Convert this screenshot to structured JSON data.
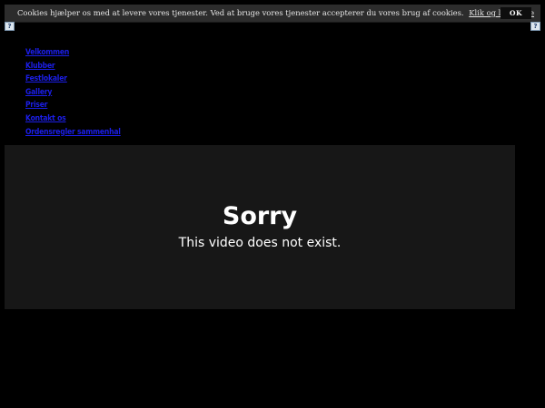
{
  "cookie_banner": {
    "text": "Cookies hjælper os med at levere vores tjenester. Ved at bruge vores tjenester accepterer du vores brug af cookies.",
    "link_label": "Klik og læs mere",
    "ok_label": "OK"
  },
  "help_icons": {
    "left_glyph": "?",
    "right_glyph": "?"
  },
  "nav": {
    "items": [
      {
        "label": "Velkommen"
      },
      {
        "label": "Klubber"
      },
      {
        "label": "Festlokaler"
      },
      {
        "label": "Gallery"
      },
      {
        "label": "Priser"
      },
      {
        "label": "Kontakt os"
      },
      {
        "label": "Ordensregler sammenhal"
      }
    ],
    "link_color": "#1b1ee8"
  },
  "video": {
    "title": "Sorry",
    "message": "This video does not exist."
  },
  "colors": {
    "page_background": "#000000",
    "banner_background": "#2c2c2c",
    "video_background": "#171717"
  }
}
